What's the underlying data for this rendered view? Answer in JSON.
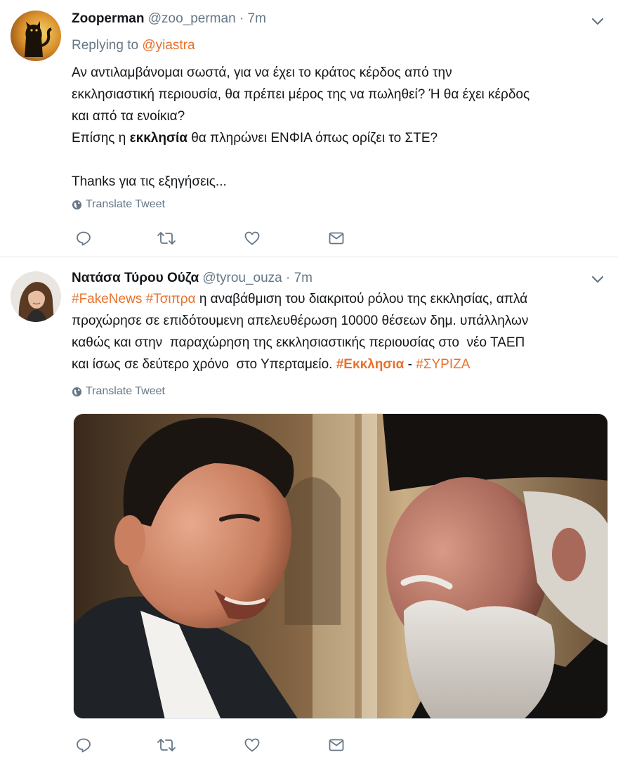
{
  "colors": {
    "link": "#e8702a",
    "muted": "#657786",
    "text": "#14171a",
    "divider": "#e6ecf0"
  },
  "tweets": [
    {
      "author_name": "Zooperman",
      "handle": "@zoo_perman",
      "separator": "·",
      "time": "7m",
      "replying_prefix": "Replying to",
      "replying_to": "@yiastra",
      "text_lines": [
        "Αν αντιλαμβάνομαι σωστά, για να έχει το κράτος κέρδος από την",
        "εκκλησιαστική περιουσία, θα πρέπει μέρος της να πωληθεί? Ή θα έχει κέρδος",
        "και από τα ενοίκια?"
      ],
      "line4_prefix": "Επίσης η ",
      "line4_bold": "εκκλησία",
      "line4_suffix": " θα πληρώνει ΕΝΦΙΑ όπως ορίζει το ΣΤΕ?",
      "line6": "Thanks για τις εξηγήσεις...",
      "translate_label": "Translate Tweet",
      "icons": [
        "reply-icon",
        "retweet-icon",
        "like-icon",
        "direct-message-icon"
      ]
    },
    {
      "author_name": "Νατάσα Τύρου Ούζα",
      "handle": "@tyrou_ouza",
      "separator": "·",
      "time": "7m",
      "tag1": "#FakeNews",
      "tag2": "#Τσιπρα",
      "line1_rest": " η αναβάθμιση του διακριτού ρόλου της εκκλησίας, απλά",
      "line2": "προχώρησε σε επιδότουμενη απελευθέρωση 10000 θέσεων δημ. υπάλληλων",
      "line3": "καθώς και στην  παραχώρηση της εκκλησιαστικής περιουσίας στο  νέο ΤΑΕΠ",
      "line4_prefix": "και ίσως σε δεύτερο χρόνο  στο Υπερταμείο. ",
      "tag3": "#Εκκλησια",
      "line4_dash": " - ",
      "tag4": "#ΣΥΡΙΖΑ",
      "translate_label": "Translate Tweet",
      "media_description": "photo-two-men",
      "icons": [
        "reply-icon",
        "retweet-icon",
        "like-icon",
        "direct-message-icon"
      ]
    }
  ]
}
